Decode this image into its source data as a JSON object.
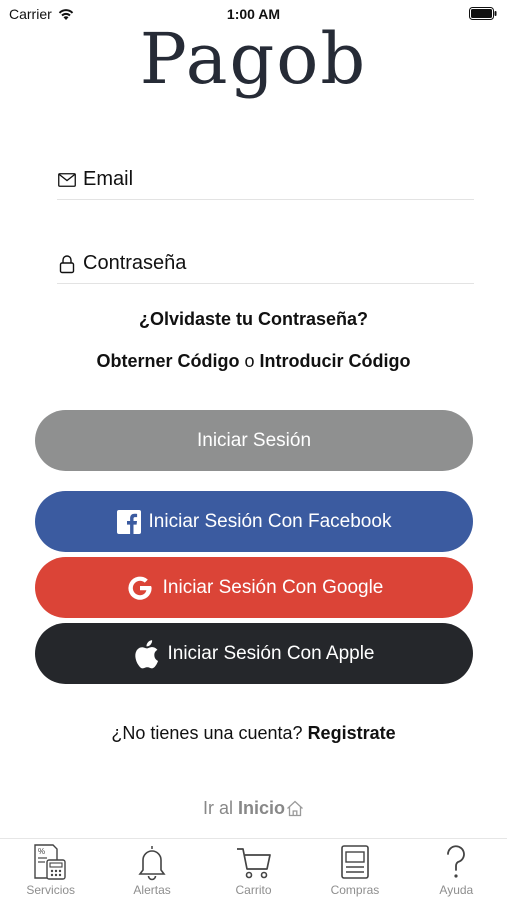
{
  "status_bar": {
    "carrier": "Carrier",
    "time": "1:00 AM"
  },
  "logo": "Pagob",
  "fields": {
    "email_placeholder": "Email",
    "password_placeholder": "Contraseña"
  },
  "forgot_password": "¿Olvidaste tu Contraseña?",
  "code": {
    "get": "Obterner Código",
    "or": "o",
    "enter": "Introducir Código"
  },
  "buttons": {
    "login": "Iniciar Sesión",
    "facebook": "Iniciar Sesión Con Facebook",
    "google": "Iniciar Sesión Con Google",
    "apple": "Iniciar Sesión Con Apple"
  },
  "signup": {
    "question": "¿No tienes una cuenta?",
    "link": "Registrate"
  },
  "home": {
    "prefix": "Ir al",
    "link": "Inicio"
  },
  "tabs": [
    {
      "label": "Servicios",
      "icon": "services-icon"
    },
    {
      "label": "Alertas",
      "icon": "bell-icon"
    },
    {
      "label": "Carrito",
      "icon": "cart-icon"
    },
    {
      "label": "Compras",
      "icon": "receipt-icon"
    },
    {
      "label": "Ayuda",
      "icon": "question-icon"
    }
  ],
  "colors": {
    "login": "#8f9090",
    "facebook": "#3b5ba0",
    "google": "#db4437",
    "apple": "#25272b",
    "logo": "#262b36"
  }
}
